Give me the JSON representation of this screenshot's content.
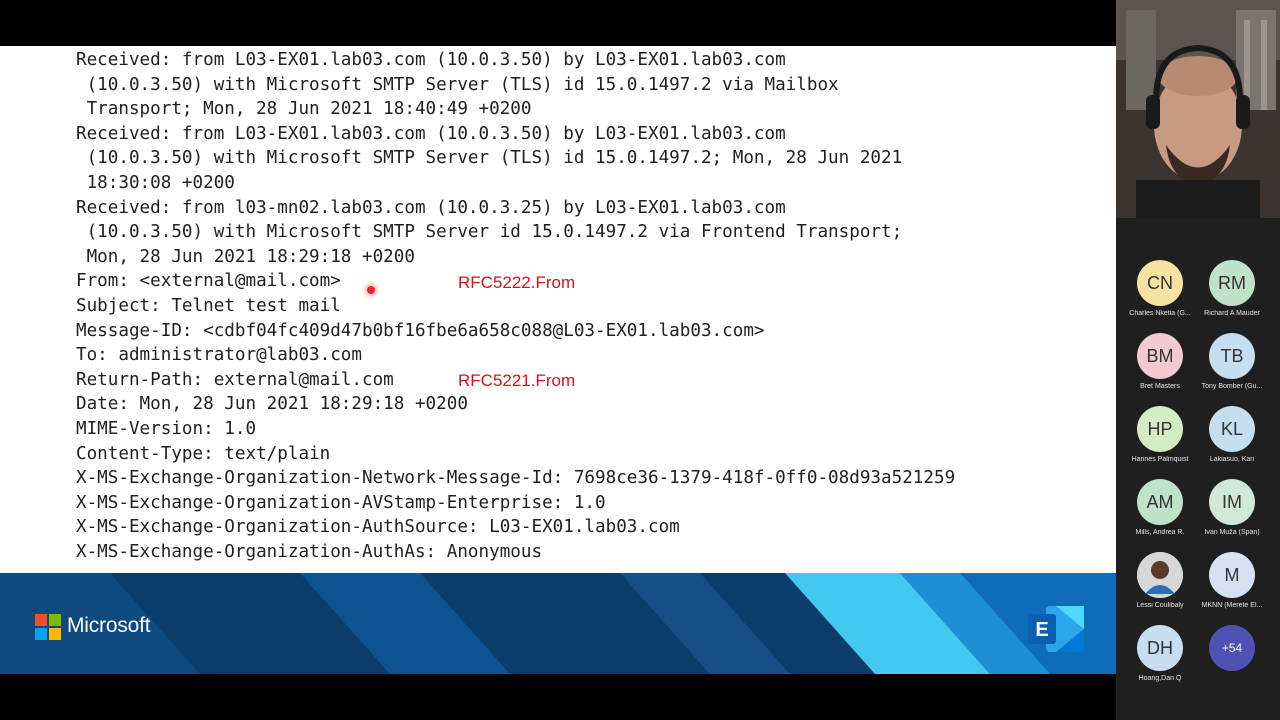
{
  "header_lines": [
    "Received: from L03-EX01.lab03.com (10.0.3.50) by L03-EX01.lab03.com",
    " (10.0.3.50) with Microsoft SMTP Server (TLS) id 15.0.1497.2 via Mailbox",
    " Transport; Mon, 28 Jun 2021 18:40:49 +0200",
    "Received: from L03-EX01.lab03.com (10.0.3.50) by L03-EX01.lab03.com",
    " (10.0.3.50) with Microsoft SMTP Server (TLS) id 15.0.1497.2; Mon, 28 Jun 2021",
    " 18:30:08 +0200",
    "Received: from l03-mn02.lab03.com (10.0.3.25) by L03-EX01.lab03.com",
    " (10.0.3.50) with Microsoft SMTP Server id 15.0.1497.2 via Frontend Transport;",
    " Mon, 28 Jun 2021 18:29:18 +0200",
    "From: <external@mail.com>",
    "Subject: Telnet test mail",
    "Message-ID: <cdbf04fc409d47b0bf16fbe6a658c088@L03-EX01.lab03.com>",
    "To: administrator@lab03.com",
    "Return-Path: external@mail.com",
    "Date: Mon, 28 Jun 2021 18:29:18 +0200",
    "MIME-Version: 1.0",
    "Content-Type: text/plain",
    "X-MS-Exchange-Organization-Network-Message-Id: 7698ce36-1379-418f-0ff0-08d93a521259",
    "X-MS-Exchange-Organization-AVStamp-Enterprise: 1.0",
    "X-MS-Exchange-Organization-AuthSource: L03-EX01.lab03.com",
    "X-MS-Exchange-Organization-AuthAs: Anonymous"
  ],
  "annotations": {
    "from_label": "RFC5222.From",
    "return_path_label": "RFC5221.From"
  },
  "banner": {
    "brand": "Microsoft",
    "exchange_letter": "E"
  },
  "participants": [
    {
      "initials": "CN",
      "name": "Charles Nketia (G...",
      "color": "#f6e3a1"
    },
    {
      "initials": "RM",
      "name": "Richard A Mauder",
      "color": "#bfe3c9"
    },
    {
      "initials": "BM",
      "name": "Bret Masters",
      "color": "#f2c9cf"
    },
    {
      "initials": "TB",
      "name": "Tony Bomber (Gu...",
      "color": "#c6dff0"
    },
    {
      "initials": "HP",
      "name": "Hannes Palmquist",
      "color": "#d4ecc4"
    },
    {
      "initials": "KL",
      "name": "Lakiasuo, Kari",
      "color": "#c6dff0"
    },
    {
      "initials": "AM",
      "name": "Mills, Andrea R.",
      "color": "#bfe3c9"
    },
    {
      "initials": "IM",
      "name": "Ivan Muža (Span)",
      "color": "#cfe9d6"
    },
    {
      "initials": "",
      "name": "Lessi Coulibaly",
      "color": "#d7d7d7"
    },
    {
      "initials": "M",
      "name": "MKNN (Merete El...",
      "color": "#d6e2f2"
    },
    {
      "initials": "DH",
      "name": "Hoang,Dan Q",
      "color": "#c6dff0"
    }
  ],
  "more_count": "+54",
  "colors": {
    "annotation": "#d0141b",
    "banner_dark": "#0b3d6b",
    "banner_cyan": "#43c8f0",
    "more_badge": "#4f52b2"
  },
  "icons": [
    "microsoft-logo-icon",
    "exchange-logo-icon",
    "laser-pointer-icon"
  ]
}
